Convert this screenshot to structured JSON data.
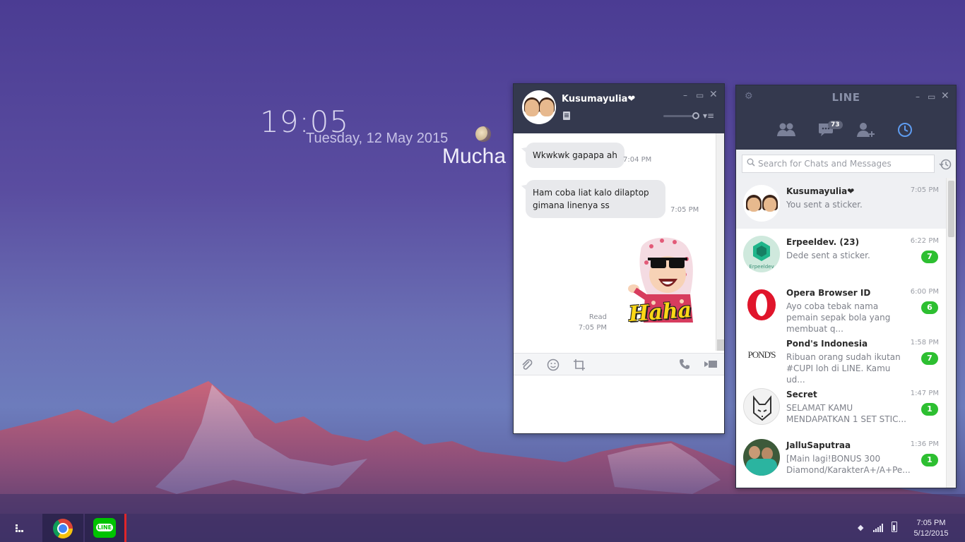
{
  "desktop": {
    "clock": "19:05",
    "date": "Tuesday, 12 May 2015",
    "user_name_partial": "Mucha"
  },
  "chat_window": {
    "contact_name": "Kusumayulia❤",
    "messages": [
      {
        "text": "Wkwkwk gapapa ah",
        "time": "7:04 PM",
        "side": "received"
      },
      {
        "text": "Ham coba liat kalo dilaptop gimana linenya ss",
        "time": "7:05 PM",
        "side": "received"
      }
    ],
    "sent_sticker": {
      "status": "Read",
      "time": "7:05 PM",
      "sticker_text": "Haha"
    },
    "icons": [
      "attach-icon",
      "emoji-icon",
      "crop-icon",
      "phone-icon",
      "video-icon"
    ]
  },
  "line_window": {
    "title": "LINE",
    "chats_badge": "73",
    "search_placeholder": "Search for Chats and Messages",
    "chats": [
      {
        "name": "Kusumayulia❤",
        "preview": "You sent a sticker.",
        "time": "7:05 PM",
        "unread": null,
        "selected": true
      },
      {
        "name": "Erpeeldev. (23)",
        "preview": "Dede sent a sticker.",
        "time": "6:22 PM",
        "unread": "7",
        "avatar_text": "Erpeeldev"
      },
      {
        "name": "Opera Browser ID",
        "preview": "Ayo coba tebak nama pemain sepak bola yang membuat q...",
        "time": "6:00 PM",
        "unread": "6"
      },
      {
        "name": "Pond's Indonesia",
        "preview": "Ribuan orang sudah ikutan #CUPI loh di LINE. Kamu ud...",
        "time": "1:58 PM",
        "unread": "7",
        "avatar_text": "POND'S"
      },
      {
        "name": "Secret",
        "preview": "SELAMAT KAMU MENDAPATKAN 1 SET STIC...",
        "time": "1:47 PM",
        "unread": "1"
      },
      {
        "name": "JalluSaputraa",
        "preview": "[Main lagi!BONUS 300 Diamond/KarakterA+/A+Pe...",
        "time": "1:36 PM",
        "unread": "1"
      }
    ]
  },
  "taskbar": {
    "line_label": "LINE",
    "time": "7:05 PM",
    "date": "5/12/2015"
  },
  "colors": {
    "titlebar": "#34394e",
    "unread_badge": "#2dbf31",
    "active_tab": "#5e9cf0"
  }
}
